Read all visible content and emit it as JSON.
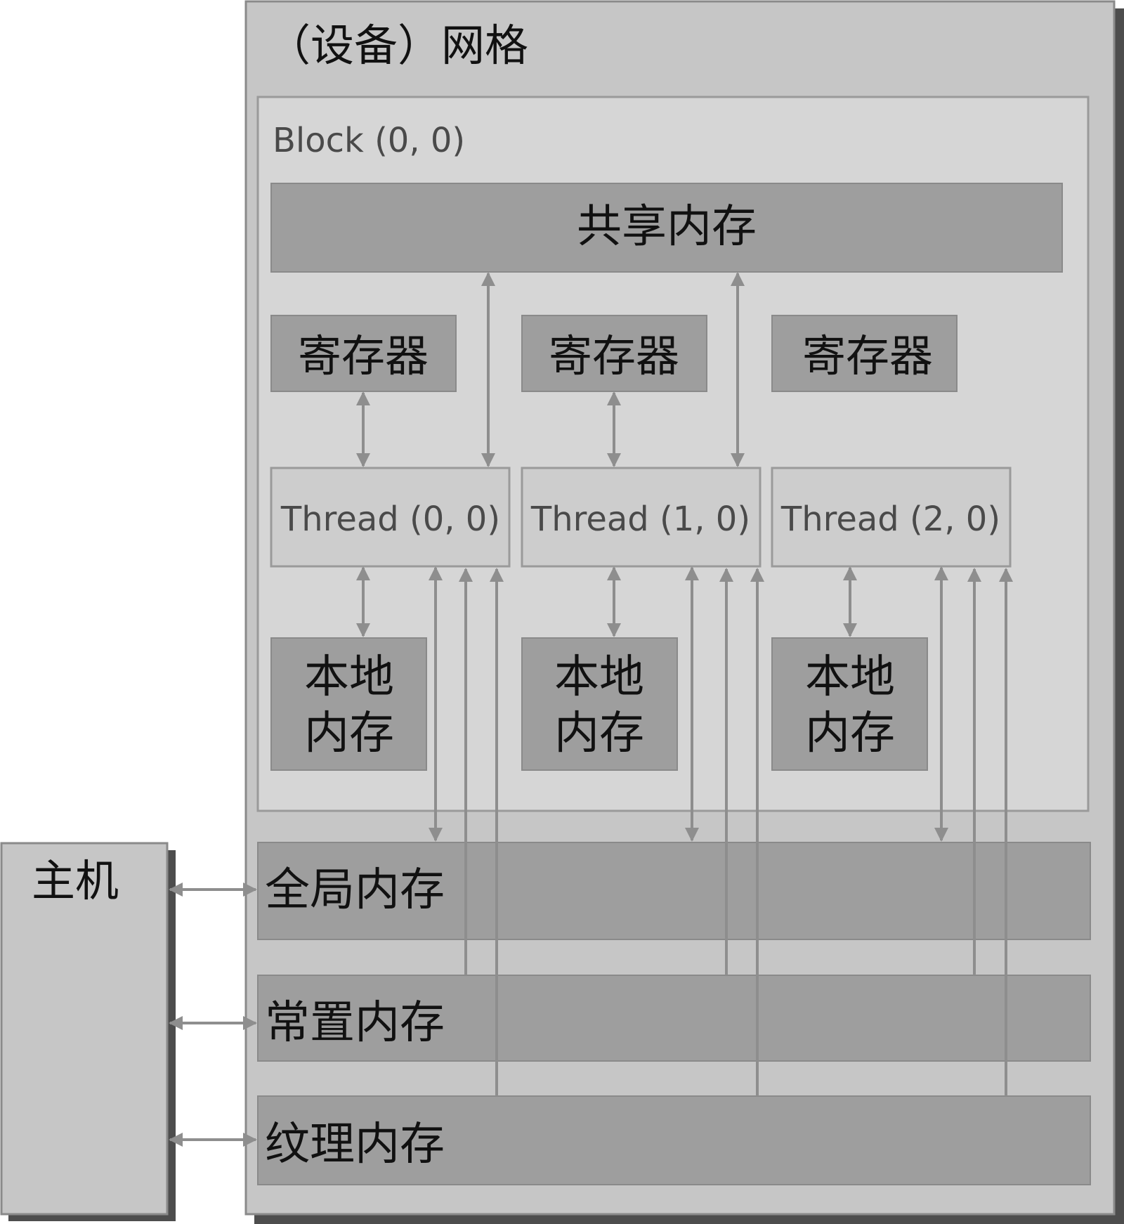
{
  "grid": {
    "title": "（设备）网格"
  },
  "block": {
    "label": "Block (0, 0)"
  },
  "shared_memory": {
    "label": "共享内存"
  },
  "threads": [
    {
      "label": "Thread (0, 0)",
      "registers": "寄存器",
      "local_memory": [
        "本地",
        "内存"
      ]
    },
    {
      "label": "Thread (1, 0)",
      "registers": "寄存器",
      "local_memory": [
        "本地",
        "内存"
      ]
    },
    {
      "label": "Thread (2, 0)",
      "registers": "寄存器",
      "local_memory": [
        "本地",
        "内存"
      ]
    }
  ],
  "host": {
    "label": "主机"
  },
  "memories": {
    "global": "全局内存",
    "constant": "常置内存",
    "texture": "纹理内存"
  },
  "colors": {
    "grid_bg": "#c6c6c6",
    "block_bg": "#d6d6d6",
    "dark_box": "#9e9e9e",
    "thread_box": "#cdcdcd",
    "arrow": "#8e8e8e",
    "shadow": "#4d4d4d",
    "border": "#8a8a8a"
  }
}
